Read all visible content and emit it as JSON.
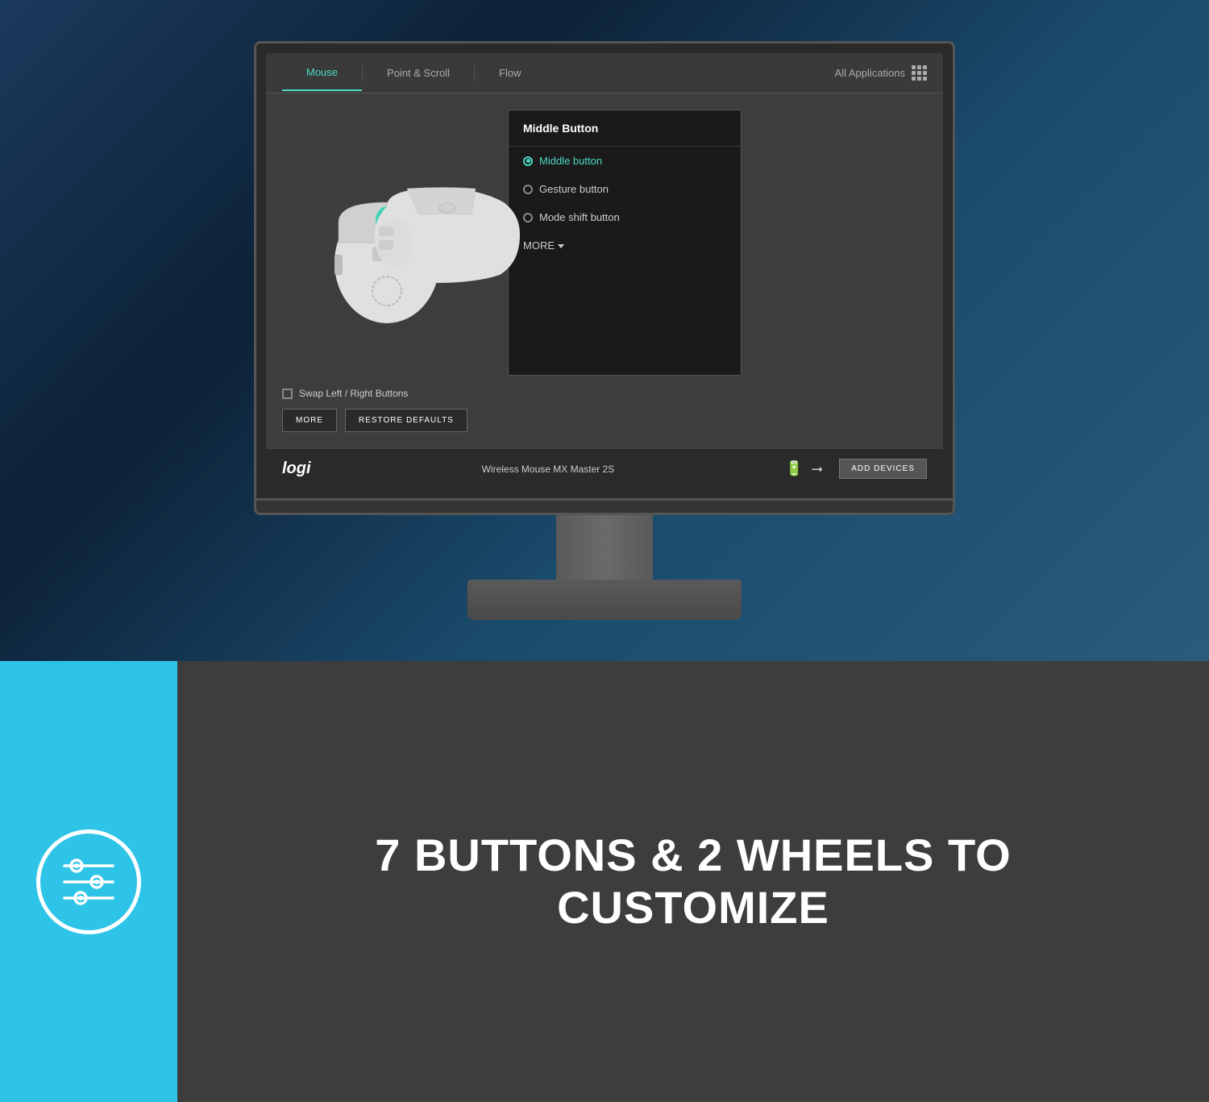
{
  "nav": {
    "tab_mouse": "Mouse",
    "tab_point_scroll": "Point & Scroll",
    "tab_flow": "Flow",
    "all_applications": "All Applications"
  },
  "dropdown": {
    "title": "Middle Button",
    "options": [
      {
        "label": "Middle button",
        "selected": true
      },
      {
        "label": "Gesture button",
        "selected": false
      },
      {
        "label": "Mode shift button",
        "selected": false
      }
    ],
    "more_label": "MORE"
  },
  "controls": {
    "swap_label": "Swap Left / Right Buttons",
    "more_btn": "MORE",
    "restore_btn": "RESTORE DEFAULTS"
  },
  "footer": {
    "logo": "logi",
    "device_name": "Wireless Mouse MX Master 2S",
    "add_devices": "ADD DEVICES"
  },
  "banner": {
    "line1": "7 BUTTONS & 2 WHEELS TO",
    "line2": "CUSTOMIZE"
  }
}
